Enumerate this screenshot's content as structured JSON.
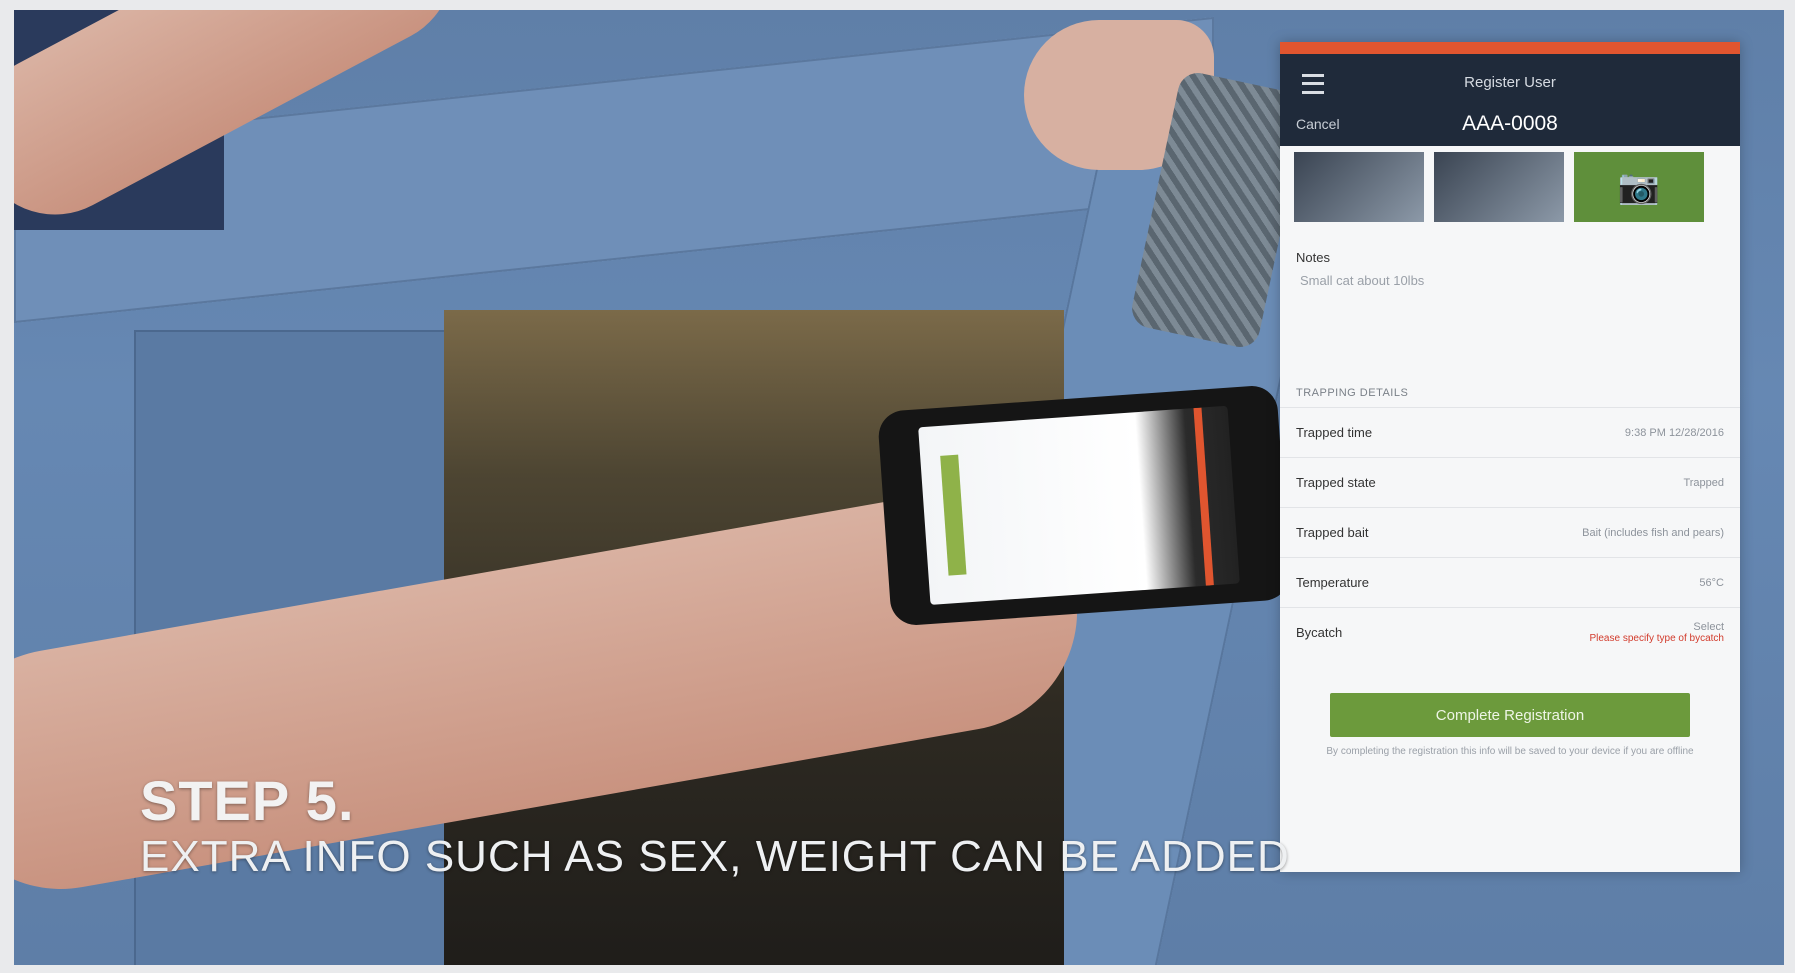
{
  "app": {
    "title": "Register User",
    "cancel_label": "Cancel",
    "tag_id": "AAA-0008",
    "add_photo_icon": "camera-plus-icon",
    "notes_label": "Notes",
    "notes_placeholder": "Small cat about 10lbs",
    "section_title": "Trapping details",
    "rows": [
      {
        "label": "Trapped time",
        "value": "9:38 PM 12/28/2016"
      },
      {
        "label": "Trapped state",
        "value": "Trapped"
      },
      {
        "label": "Trapped bait",
        "value": "Bait (includes fish and pears)"
      },
      {
        "label": "Temperature",
        "value": "56°C"
      },
      {
        "label": "Bycatch",
        "value": "Select",
        "warning": "Please specify type of bycatch"
      }
    ],
    "complete_button": "Complete Registration",
    "disclaimer": "By completing the registration this info will be saved to your device if you are offline"
  },
  "caption": {
    "step": "STEP 5.",
    "text": "EXTRA INFO SUCH AS SEX, WEIGHT CAN BE ADDED"
  },
  "colors": {
    "header": "#1f2a3a",
    "status_bar": "#e0552f",
    "accent_green": "#6c9a3c"
  }
}
